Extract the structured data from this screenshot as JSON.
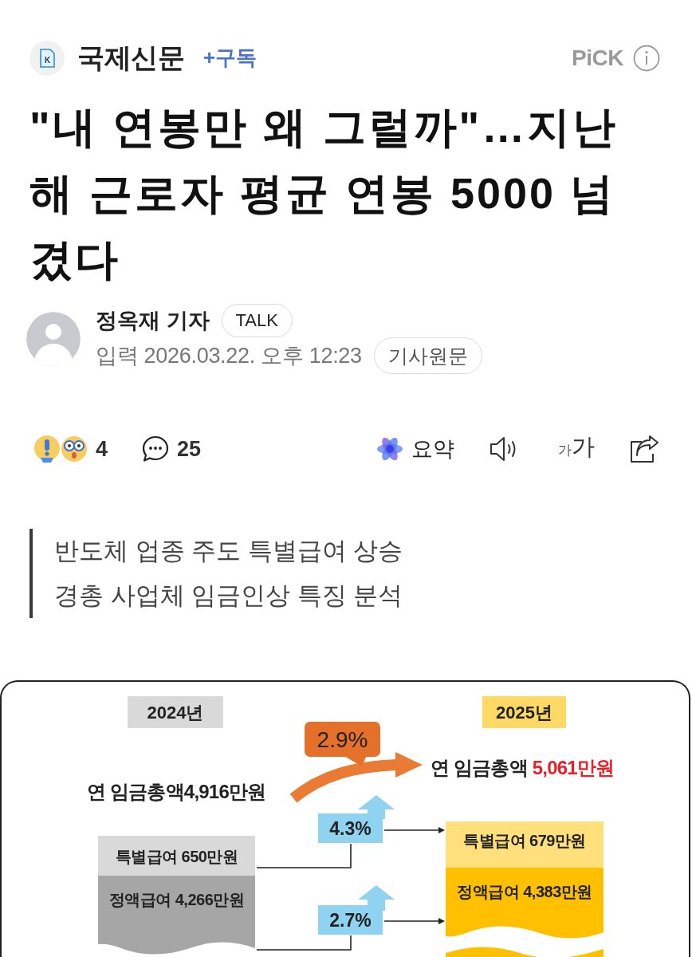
{
  "header": {
    "logo_letter": "K",
    "press": "국제신문",
    "subscribe": "+구독",
    "pick": "PiCK"
  },
  "headline": "\"내 연봉만 왜 그럴까\"…지난 해 근로자 평균 연봉 5000 넘겼다",
  "byline": {
    "reporter": "정옥재 기자",
    "talk": "TALK",
    "date": "입력 2026.03.22. 오후 12:23",
    "original": "기사원문"
  },
  "actions": {
    "reactions": "4",
    "comments": "25",
    "summary": "요약",
    "font_small": "가",
    "font_large": "가"
  },
  "subtitle": [
    "반도체 업종 주도 특별급여 상승",
    "경총 사업체 임금인상 특징 분석"
  ],
  "infographic": {
    "years": [
      "2024년",
      "2025년"
    ],
    "total_change": "2.9%",
    "total_before": "연 임금총액4,916만원",
    "total_after": {
      "label": "연 임금총액",
      "amount": "5,061만원"
    },
    "rows": [
      {
        "before": "특별급여 650만원",
        "change": "4.3%",
        "after": "특별급여 679만원"
      },
      {
        "before": "정액급여 4,266만원",
        "change": "2.7%",
        "after": "정액급여 4,383만원"
      }
    ]
  }
}
